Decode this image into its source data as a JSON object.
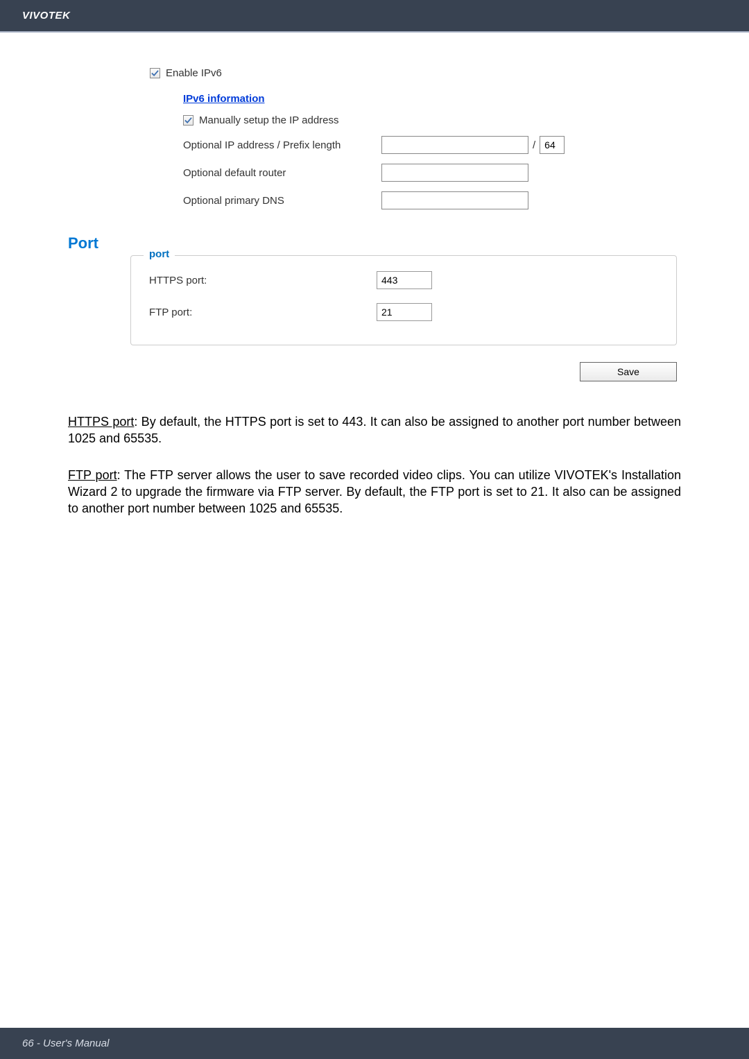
{
  "header": {
    "brand": "VIVOTEK"
  },
  "ipv6": {
    "enable_label": "Enable IPv6",
    "info_link": "IPv6 information",
    "manual_label": "Manually setup the IP address",
    "opt_ip_label": "Optional IP address / Prefix length",
    "opt_ip_value": "",
    "slash": "/",
    "prefix_value": "64",
    "opt_router_label": "Optional default router",
    "opt_router_value": "",
    "opt_dns_label": "Optional primary DNS",
    "opt_dns_value": ""
  },
  "port": {
    "heading": "Port",
    "legend": "port",
    "https_label": "HTTPS port:",
    "https_value": "443",
    "ftp_label": "FTP port:",
    "ftp_value": "21"
  },
  "save_button": "Save",
  "para1": {
    "label": "HTTPS port",
    "text": ": By default, the HTTPS port is set to 443. It can also be assigned to another port number between 1025 and 65535."
  },
  "para2": {
    "label": "FTP port",
    "text": ": The FTP server allows the user to save recorded video clips. You can utilize VIVOTEK's Installation Wizard 2 to upgrade the firmware via FTP server. By default, the FTP port is set to 21. It also can be assigned to another port number between 1025 and 65535."
  },
  "footer": {
    "text": "66 - User's Manual"
  }
}
